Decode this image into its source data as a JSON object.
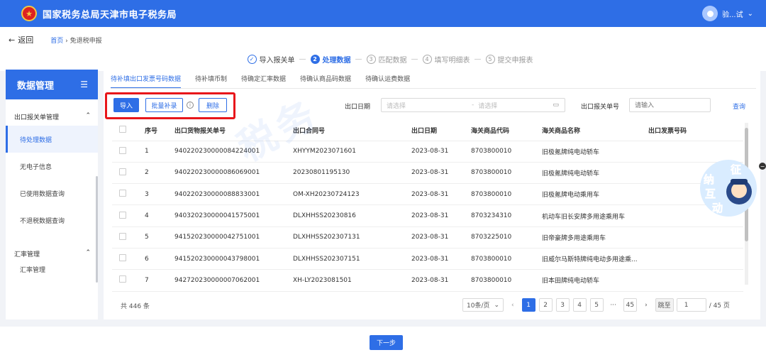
{
  "header": {
    "title": "国家税务总局天津市电子税务局",
    "user_name": "验...试"
  },
  "breadcrumb": {
    "back_label": "返回",
    "home": "首页",
    "separator": "›",
    "current": "免退税申报"
  },
  "steps": [
    {
      "num": "✓",
      "label": "导入报关单",
      "state": "done"
    },
    {
      "num": "2",
      "label": "处理数据",
      "state": "active"
    },
    {
      "num": "3",
      "label": "匹配数据",
      "state": "todo"
    },
    {
      "num": "4",
      "label": "填写明细表",
      "state": "todo"
    },
    {
      "num": "5",
      "label": "提交申报表",
      "state": "todo"
    }
  ],
  "sidebar": {
    "title": "数据管理",
    "groups": [
      {
        "label": "出口报关单管理",
        "items": [
          "待处理数据",
          "无电子信息",
          "已使用数据查询",
          "不退税数据查询"
        ]
      },
      {
        "label": "汇率管理",
        "items": [
          "汇率管理"
        ]
      }
    ]
  },
  "tabs": [
    "待补填出口发票号码数据",
    "待补填币制",
    "待确定汇率数据",
    "待确认商品码数据",
    "待确认运费数据"
  ],
  "toolbar": {
    "import": "导入",
    "batch_add": "批量补录",
    "delete": "删除"
  },
  "filters": {
    "export_date_label": "出口日期",
    "date_start_placeholder": "请选择",
    "date_end_placeholder": "请选择",
    "declaration_no_label": "出口报关单号",
    "declaration_no_placeholder": "请输入",
    "query": "查询"
  },
  "table": {
    "columns": [
      "序号",
      "出口货物报关单号",
      "出口合同号",
      "出口日期",
      "海关商品代码",
      "海关商品名称",
      "出口发票号码"
    ],
    "rows": [
      [
        "1",
        "940220230000084224001",
        "XHYYM2023071601",
        "2023-08-31",
        "8703800010",
        "旧极氪牌纯电动轿车",
        ""
      ],
      [
        "2",
        "940220230000086069001",
        "20230801195130",
        "2023-08-31",
        "8703800010",
        "旧极氪牌纯电动轿车",
        ""
      ],
      [
        "3",
        "940220230000088833001",
        "OM-XH20230724123",
        "2023-08-31",
        "8703800010",
        "旧极氪牌电动乘用车",
        ""
      ],
      [
        "4",
        "940320230000041575001",
        "DLXHHSS20230816",
        "2023-08-31",
        "8703234310",
        "机动车旧长安牌多用途乘用车",
        ""
      ],
      [
        "5",
        "941520230000042751001",
        "DLXHHSS202307131",
        "2023-08-31",
        "8703225010",
        "旧帝豪牌多用途乘用车",
        ""
      ],
      [
        "6",
        "941520230000043798001",
        "DLXHHSS202307151",
        "2023-08-31",
        "8703800010",
        "旧威尔马斯特牌纯电动多用途乘...",
        ""
      ],
      [
        "7",
        "942720230000007062001",
        "XH-LY2023081501",
        "2023-08-31",
        "8703800010",
        "旧本田牌纯电动轿车",
        ""
      ]
    ]
  },
  "pagination": {
    "total": "共 446 条",
    "page_size": "10条/页",
    "pages": [
      "1",
      "2",
      "3",
      "4",
      "5",
      "···",
      "45"
    ],
    "current": "1",
    "jump_label": "跳至",
    "jump_value": "1",
    "page_count": "/ 45 页"
  },
  "next_button": "下一步",
  "float_badge": {
    "chars": [
      "征",
      "纳",
      "互",
      "动"
    ]
  }
}
